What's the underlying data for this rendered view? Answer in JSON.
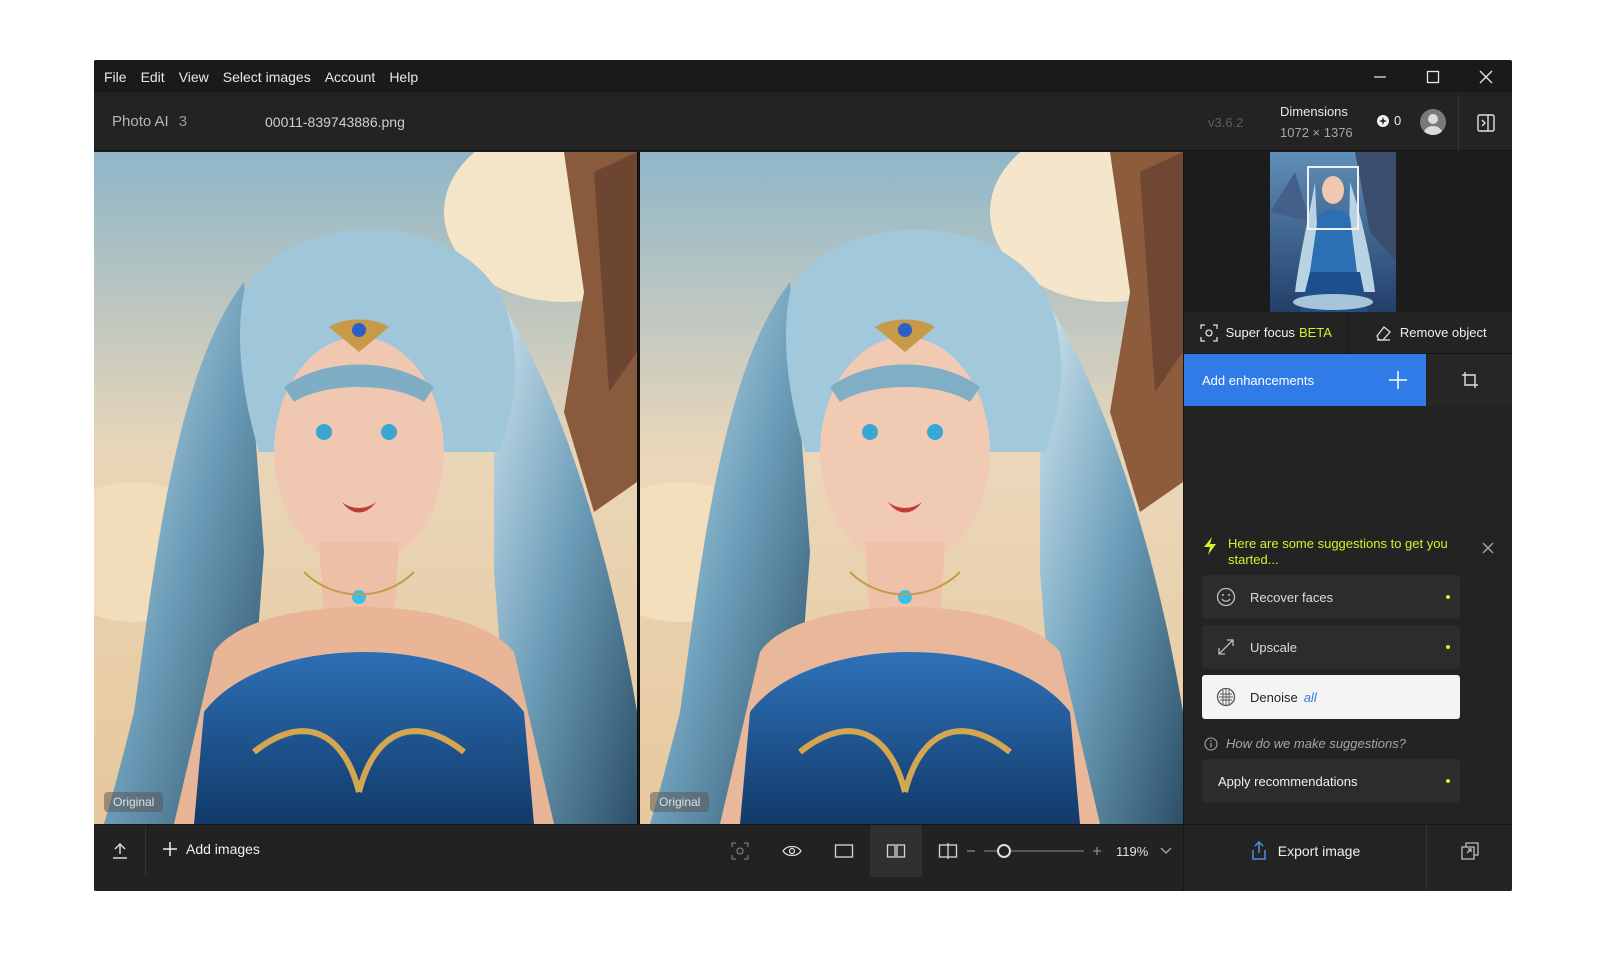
{
  "menu": [
    "File",
    "Edit",
    "View",
    "Select images",
    "Account",
    "Help"
  ],
  "header": {
    "brand": "Photo AI",
    "brand_version": "3",
    "filename": "00011-839743886.png",
    "app_version": "v3.6.2",
    "dimensions_label": "Dimensions",
    "dimensions_value": "1072 × 1376",
    "credits": "0"
  },
  "panes": {
    "left_label": "Original",
    "right_label": "Original"
  },
  "side": {
    "super_focus": "Super focus",
    "beta": "BETA",
    "remove_object": "Remove object",
    "add_enhancements": "Add enhancements",
    "suggestions_text": "Here are some suggestions to get you started...",
    "items": [
      {
        "label": "Recover faces",
        "icon": "face-icon"
      },
      {
        "label": "Upscale",
        "icon": "upscale-icon"
      },
      {
        "label": "Denoise",
        "tag": "all",
        "icon": "denoise-icon"
      }
    ],
    "how_link": "How do we make suggestions?",
    "apply": "Apply recommendations",
    "export": "Export image"
  },
  "bottom": {
    "add_images": "Add images",
    "zoom": "119%",
    "zoom_level": 0.2
  },
  "colors": {
    "accent_blue": "#2f7be8",
    "accent_lime": "#d6ef2d",
    "panel_bg": "#232323"
  }
}
